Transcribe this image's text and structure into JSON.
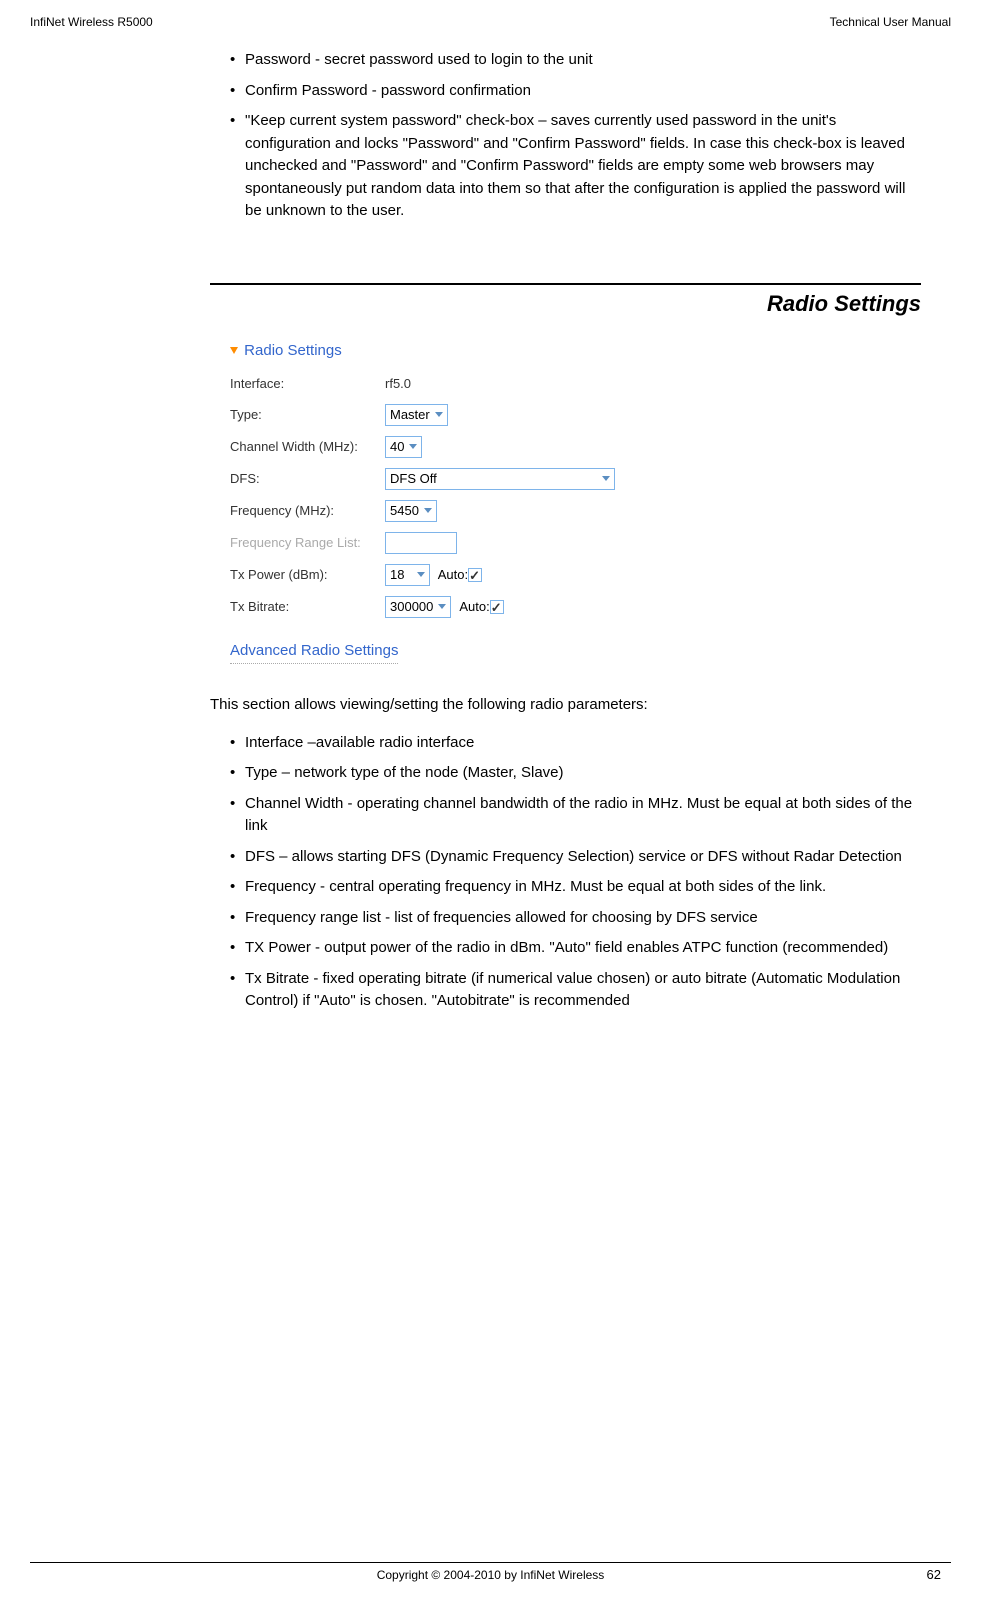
{
  "header": {
    "left": "InfiNet Wireless R5000",
    "right": "Technical User Manual"
  },
  "topList": {
    "item1": "Password - secret password used to login to the unit",
    "item2": "Confirm Password - password confirmation",
    "item3": "\"Keep current system password\" check-box – saves currently used password in the unit's configuration and locks \"Password\" and \"Confirm Password\" fields. In case this check-box is leaved unchecked and \"Password\" and \"Confirm Password\" fields are empty some web browsers may spontaneously put random data into them so that after the configuration is applied the password will be unknown to the user."
  },
  "sectionTitle": "Radio Settings",
  "screenshot": {
    "title": "Radio Settings",
    "rows": {
      "interface": {
        "label": "Interface:",
        "value": "rf5.0"
      },
      "type": {
        "label": "Type:",
        "value": "Master"
      },
      "channelWidth": {
        "label": "Channel Width (MHz):",
        "value": "40"
      },
      "dfs": {
        "label": "DFS:",
        "value": "DFS Off"
      },
      "frequency": {
        "label": "Frequency (MHz):",
        "value": "5450"
      },
      "freqRange": {
        "label": "Frequency Range List:"
      },
      "txPower": {
        "label": "Tx Power (dBm):",
        "value": "18",
        "auto": "Auto:"
      },
      "txBitrate": {
        "label": "Tx Bitrate:",
        "value": "300000",
        "auto": "Auto:"
      }
    },
    "advanced": "Advanced Radio Settings"
  },
  "intro": "This section allows viewing/setting the following radio parameters:",
  "paramList": {
    "item1": "Interface –available radio interface",
    "item2": "Type – network type of the node (Master, Slave)",
    "item3": "Channel Width - operating channel bandwidth of the radio in MHz. Must be equal at both sides of the link",
    "item4": "DFS – allows starting DFS (Dynamic Frequency Selection) service or DFS without Radar Detection",
    "item5": "Frequency - central operating frequency in MHz. Must be equal at both sides of the link.",
    "item6": "Frequency range list - list of frequencies allowed for choosing by DFS service",
    "item7": "TX Power - output power of the radio in dBm. \"Auto\" field enables ATPC function (recommended)",
    "item8": "Tx Bitrate - fixed operating bitrate (if numerical value chosen) or auto bitrate (Automatic Modulation Control) if \"Auto\" is chosen. \"Autobitrate\" is recommended"
  },
  "footer": {
    "copyright": "Copyright © 2004-2010 by InfiNet Wireless",
    "page": "62"
  }
}
